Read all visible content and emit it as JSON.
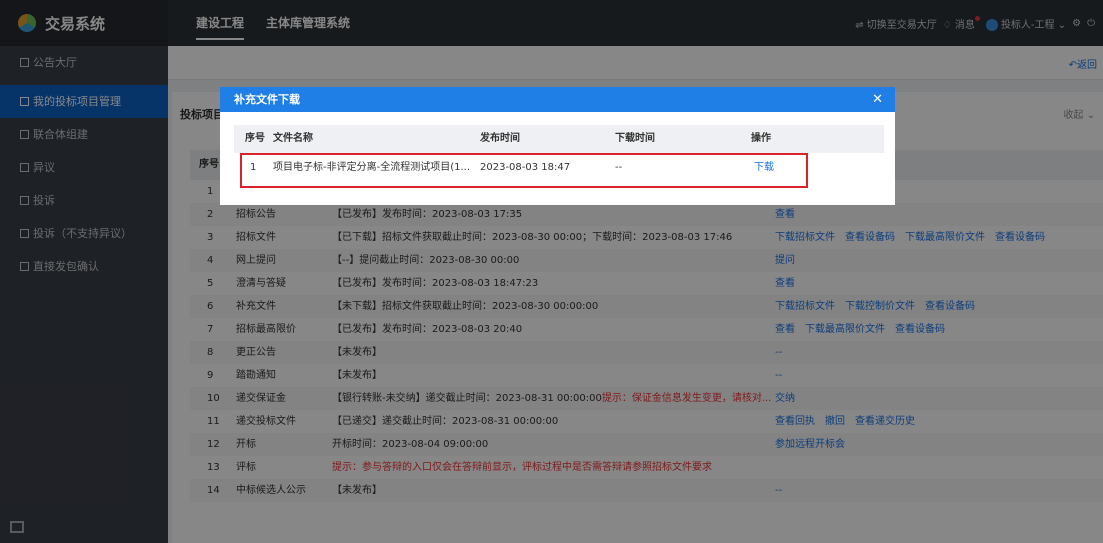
{
  "app": {
    "title": "交易系统"
  },
  "nav": {
    "tabs": [
      {
        "label": "建设工程"
      },
      {
        "label": "主体库管理系统"
      }
    ]
  },
  "topright": {
    "switch_label": "⇌ 切换至交易大厅",
    "messages_label": "♢ 消息",
    "user_label": "投标人-工程 ⌄",
    "settings_icon": "gear-icon",
    "power_icon": "power-icon"
  },
  "sidebar": {
    "items": [
      {
        "label": "公告大厅",
        "active": false
      },
      {
        "label": "我的投标项目管理",
        "active": true
      },
      {
        "label": "联合体组建",
        "active": false
      },
      {
        "label": "异议",
        "active": false
      },
      {
        "label": "投诉",
        "active": false
      },
      {
        "label": "投诉（不支持异议）",
        "active": false
      },
      {
        "label": "直接发包确认",
        "active": false
      }
    ]
  },
  "main": {
    "back_label": "↶返回",
    "panel_title": "投标项目",
    "collapse_label": "收起 ⌄"
  },
  "table": {
    "headers": {
      "no": "序号"
    },
    "rows": [
      {
        "no": "1",
        "node": "",
        "status": "",
        "ops": []
      },
      {
        "no": "2",
        "node": "招标公告",
        "status": "【已发布】发布时间：2023-08-03 17:35",
        "ops": [
          "查看"
        ]
      },
      {
        "no": "3",
        "node": "招标文件",
        "status": "【已下载】招标文件获取截止时间：2023-08-30 00:00；下载时间：2023-08-03 17:46",
        "ops": [
          "下载招标文件",
          "查看设备码",
          "下载最高限价文件",
          "查看设备码"
        ]
      },
      {
        "no": "4",
        "node": "网上提问",
        "status": "【--】提问截止时间：2023-08-30 00:00",
        "ops": [
          "提问"
        ]
      },
      {
        "no": "5",
        "node": "澄清与答疑",
        "status": "【已发布】发布时间：2023-08-03 18:47:23",
        "ops": [
          "查看"
        ]
      },
      {
        "no": "6",
        "node": "补充文件",
        "status": "【未下载】招标文件获取截止时间：2023-08-30 00:00:00",
        "ops": [
          "下载招标文件",
          "下载控制价文件",
          "查看设备码"
        ]
      },
      {
        "no": "7",
        "node": "招标最高限价",
        "status": "【已发布】发布时间：2023-08-03 20:40",
        "ops": [
          "查看",
          "下载最高限价文件",
          "查看设备码"
        ]
      },
      {
        "no": "8",
        "node": "更正公告",
        "status": "【未发布】",
        "ops": [
          "--"
        ]
      },
      {
        "no": "9",
        "node": "踏勘通知",
        "status": "【未发布】",
        "ops": [
          "--"
        ]
      },
      {
        "no": "10",
        "node": "递交保证金",
        "status": "【银行转账-未交纳】递交截止时间：2023-08-31 00:00:00",
        "warn": "提示：保证金信息发生变更，请核对...",
        "ops": [
          "交纳"
        ]
      },
      {
        "no": "11",
        "node": "递交投标文件",
        "status": "【已递交】递交截止时间：2023-08-31 00:00:00",
        "ops": [
          "查看回执",
          "撤回",
          "查看递交历史"
        ]
      },
      {
        "no": "12",
        "node": "开标",
        "status": "开标时间：2023-08-04 09:00:00",
        "ops": [
          "参加远程开标会"
        ]
      },
      {
        "no": "13",
        "node": "评标",
        "status": "",
        "warn": "提示：参与答辩的入口仅会在答辩前显示，评标过程中是否需答辩请参照招标文件要求",
        "ops": []
      },
      {
        "no": "14",
        "node": "中标候选人公示",
        "status": "【未发布】",
        "ops": [
          "--"
        ]
      }
    ]
  },
  "modal": {
    "title": "补充文件下载",
    "close_icon": "close-icon",
    "headers": {
      "no": "序号",
      "name": "文件名称",
      "publish": "发布时间",
      "download": "下载时间",
      "ops": "操作"
    },
    "row": {
      "no": "1",
      "name": "项目电子标-非评定分离-全流程测试项目(1...",
      "publish": "2023-08-03 18:47",
      "download": "--",
      "op": "下载"
    }
  }
}
